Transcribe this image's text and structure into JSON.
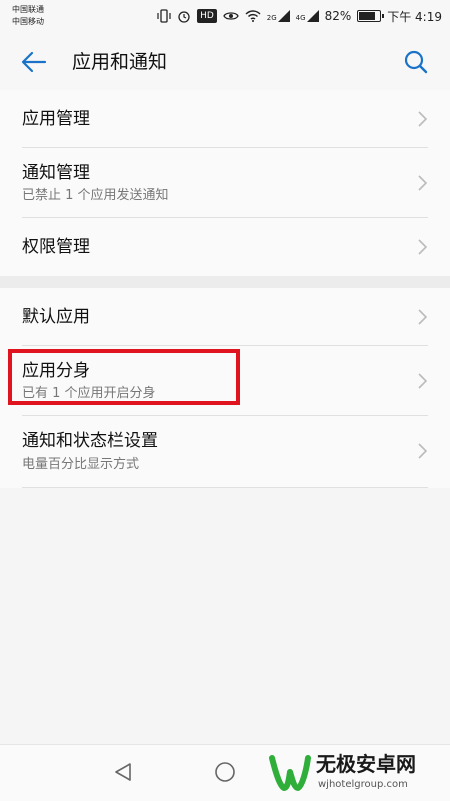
{
  "status_bar": {
    "carrier_1": "中国联通",
    "carrier_2": "中国移动",
    "hd_label": "HD",
    "net_1": "2G",
    "net_2": "4G",
    "battery_percent": "82%",
    "time": "下午 4:19"
  },
  "toolbar": {
    "title": "应用和通知"
  },
  "group_1": [
    {
      "label": "应用管理"
    },
    {
      "label": "通知管理",
      "subtitle": "已禁止 1 个应用发送通知"
    },
    {
      "label": "权限管理"
    }
  ],
  "group_2": [
    {
      "label": "默认应用"
    },
    {
      "label": "应用分身",
      "subtitle": "已有 1 个应用开启分身"
    },
    {
      "label": "通知和状态栏设置",
      "subtitle": "电量百分比显示方式"
    }
  ],
  "watermark": {
    "title": "无极安卓网",
    "url": "wjhotelgroup.com"
  },
  "colors": {
    "accent": "#1a73c8",
    "highlight": "#e0141e",
    "watermark_green": "#2fae3a"
  }
}
